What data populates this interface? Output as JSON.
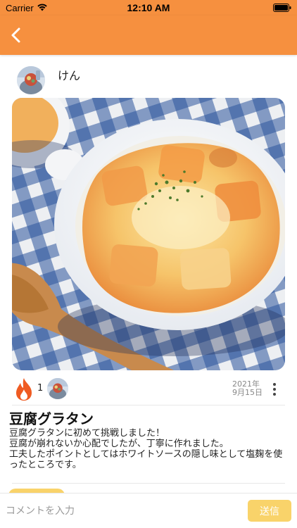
{
  "status_bar": {
    "carrier": "Carrier",
    "time": "12:10 AM",
    "icons": [
      "wifi-icon",
      "battery-icon"
    ]
  },
  "nav": {
    "back_icon": "chevron-left-icon",
    "background_color": "#f6903f"
  },
  "post": {
    "author_name": "けん",
    "like_icon": "fire-icon",
    "like_count": "1",
    "date_line1": "2021年",
    "date_line2": "9月15日",
    "more_icon": "more-vertical-icon",
    "title": "豆腐グラタン",
    "body": "豆腐グラタンに初めて挑戦しました！\n豆腐が崩れないか心配でしたが、丁寧に作れました。\n工夫したポイントとしてはホワイトソースの隠し味として塩麹を使ったところです。"
  },
  "comment": {
    "placeholder": "コメントを入力",
    "send_label": "送信"
  },
  "colors": {
    "accent": "#f6903f",
    "send_button": "#f9d36a",
    "fire": "#ef5b22"
  }
}
